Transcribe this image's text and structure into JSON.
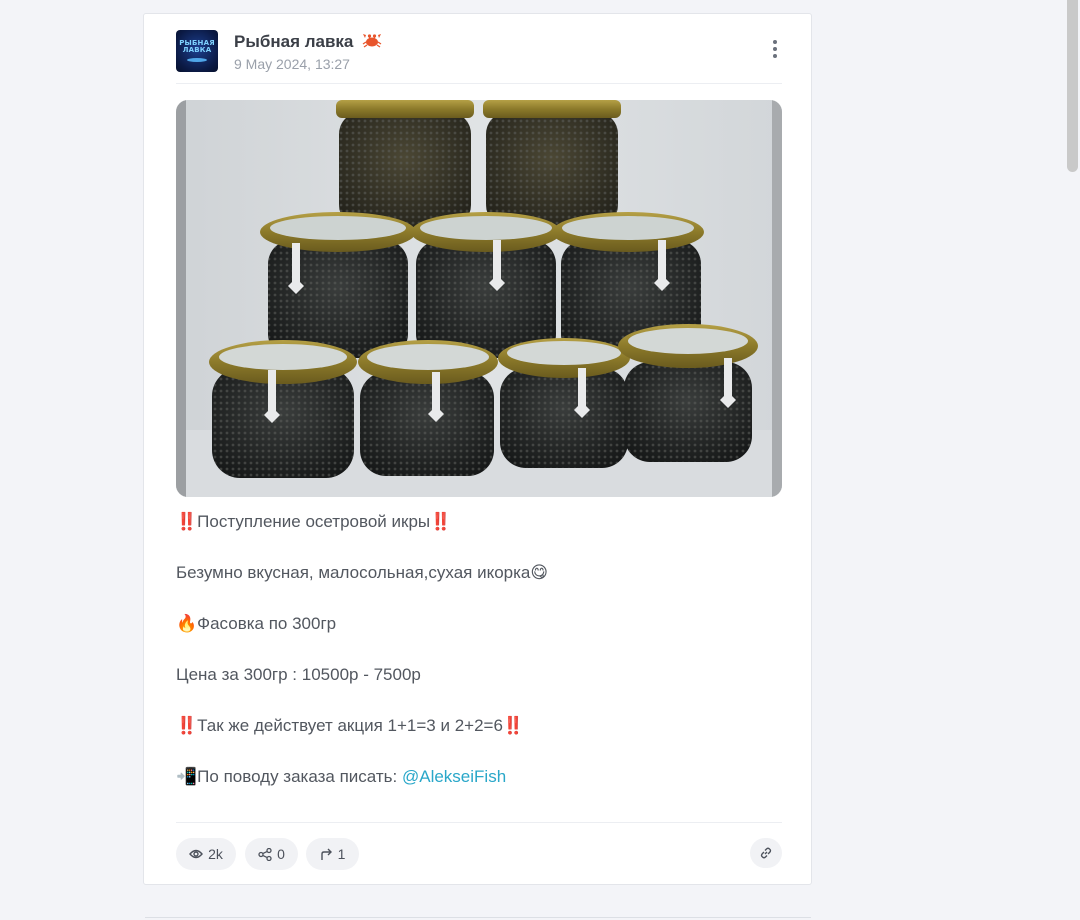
{
  "post": {
    "channel_name": "Рыбная лавка",
    "avatar_text": "РЫБНАЯ ЛАВКА",
    "date": "9 May 2024, 13:27",
    "text": {
      "line1": "Поступление осетровой икры",
      "line2": "Безумно вкусная, малосольная,сухая икорка",
      "line3": "Фасовка по 300гр",
      "line4": "Цена за 300гр : 10500р - 7500р",
      "line5": "Так же действует акция 1+1=3 и 2+2=6",
      "line6_prefix": "По поводу заказа писать: ",
      "line6_link": "@AlekseiFish"
    },
    "emoji": {
      "double_exclamation": "‼️",
      "yum": "😋",
      "fire": "🔥",
      "phone": "📲"
    },
    "stats": {
      "views": "2k",
      "shares": "0",
      "forwards": "1"
    }
  },
  "icons": {
    "crab": "crab-icon",
    "more": "more-vertical-icon",
    "eye": "eye-icon",
    "share": "share-icon",
    "forward": "forward-arrow-icon",
    "link": "link-icon"
  },
  "colors": {
    "link": "#29a7c9",
    "accent_red": "#e2253b",
    "card_bg": "#ffffff",
    "page_bg": "#f3f4f8"
  }
}
